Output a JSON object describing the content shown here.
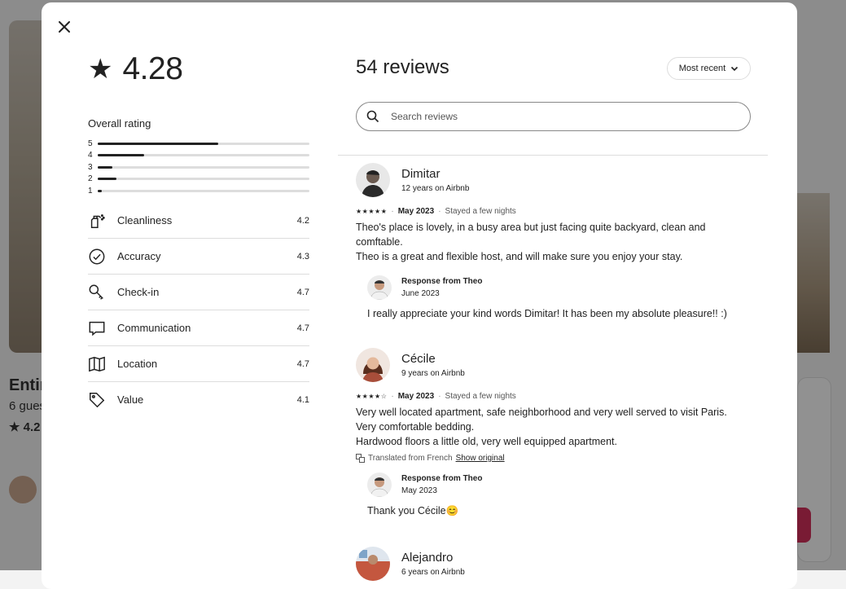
{
  "background": {
    "listing_title": "Entir",
    "listing_sub": "6 gues",
    "listing_rating": "4.2"
  },
  "modal": {
    "close_label": "✕",
    "overall": {
      "score": "4.28",
      "label": "Overall rating",
      "distribution": [
        {
          "stars": "5",
          "fraction": 0.57
        },
        {
          "stars": "4",
          "fraction": 0.22
        },
        {
          "stars": "3",
          "fraction": 0.07
        },
        {
          "stars": "2",
          "fraction": 0.09
        },
        {
          "stars": "1",
          "fraction": 0.02
        }
      ],
      "categories": [
        {
          "name": "Cleanliness",
          "score": "4.2",
          "icon": "spray-bottle-icon"
        },
        {
          "name": "Accuracy",
          "score": "4.3",
          "icon": "check-circle-icon"
        },
        {
          "name": "Check-in",
          "score": "4.7",
          "icon": "key-icon"
        },
        {
          "name": "Communication",
          "score": "4.7",
          "icon": "chat-bubble-icon"
        },
        {
          "name": "Location",
          "score": "4.7",
          "icon": "map-icon"
        },
        {
          "name": "Value",
          "score": "4.1",
          "icon": "tag-icon"
        }
      ]
    },
    "reviews_header": {
      "title": "54 reviews",
      "sort_label": "Most recent",
      "search_placeholder": "Search reviews"
    },
    "reviews": [
      {
        "name": "Dimitar",
        "tenure": "12 years on Airbnb",
        "stars": "★★★★★",
        "date": "May 2023",
        "stay": "Stayed a few nights",
        "body": [
          "Theo's place is lovely, in a busy area but just facing quite backyard, clean and comftable.",
          "Theo is a great and flexible host, and will make sure you enjoy your stay."
        ],
        "response": {
          "title": "Response from Theo",
          "date": "June 2023",
          "body": "I really appreciate your kind words Dimitar! It has been my absolute pleasure!! :)"
        }
      },
      {
        "name": "Cécile",
        "tenure": "9 years on Airbnb",
        "stars": "★★★★☆",
        "date": "May 2023",
        "stay": "Stayed a few nights",
        "body": [
          "Very well located apartment, safe neighborhood and very well served to visit Paris.",
          "Very comfortable bedding.",
          "Hardwood floors a little old, very well equipped apartment."
        ],
        "translated": "Translated from French",
        "show_original": "Show original",
        "response": {
          "title": "Response from Theo",
          "date": "May 2023",
          "body": "Thank you Cécile😊"
        }
      },
      {
        "name": "Alejandro",
        "tenure": "6 years on Airbnb"
      }
    ]
  }
}
